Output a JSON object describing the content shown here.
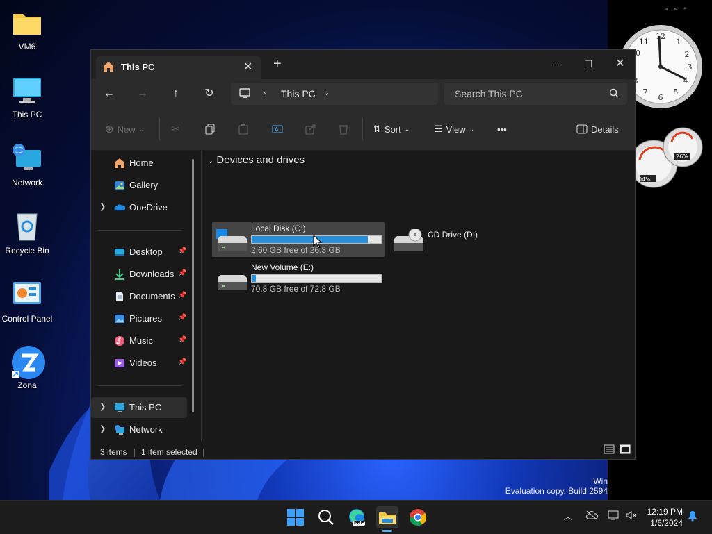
{
  "desktop": {
    "icons": [
      {
        "label": "VM6",
        "icon": "folder-icon"
      },
      {
        "label": "This PC",
        "icon": "monitor-icon"
      },
      {
        "label": "Network",
        "icon": "network-icon"
      },
      {
        "label": "Recycle Bin",
        "icon": "recycle-bin-icon"
      },
      {
        "label": "Control Panel",
        "icon": "control-panel-icon"
      },
      {
        "label": "Zona",
        "icon": "zona-icon"
      }
    ],
    "watermark": {
      "line1": "Win",
      "line2": "Evaluation copy. Build 2594"
    },
    "gadgets": {
      "cpu_label": "04%",
      "ram_label": "26%"
    }
  },
  "window": {
    "tab_title": "This PC",
    "controls": {
      "minimize": "—",
      "maximize": "☐",
      "close": "✕"
    },
    "address": {
      "location": "This PC"
    },
    "search": {
      "placeholder": "Search This PC"
    },
    "toolbar": {
      "new_label": "New",
      "sort_label": "Sort",
      "view_label": "View",
      "more_label": "•••",
      "details_label": "Details"
    },
    "nav": {
      "items": [
        {
          "label": "Home",
          "icon": "home-icon"
        },
        {
          "label": "Gallery",
          "icon": "gallery-icon"
        },
        {
          "label": "OneDrive",
          "icon": "cloud-icon"
        },
        {
          "label": "Desktop",
          "icon": "desktop-folder-icon"
        },
        {
          "label": "Downloads",
          "icon": "download-icon"
        },
        {
          "label": "Documents",
          "icon": "document-icon"
        },
        {
          "label": "Pictures",
          "icon": "pictures-icon"
        },
        {
          "label": "Music",
          "icon": "music-icon"
        },
        {
          "label": "Videos",
          "icon": "videos-icon"
        },
        {
          "label": "This PC",
          "icon": "monitor-icon"
        },
        {
          "label": "Network",
          "icon": "network-icon"
        }
      ]
    },
    "content": {
      "group_title": "Devices and drives",
      "drives": [
        {
          "name": "Local Disk (C:)",
          "free_text": "2.60 GB free of 26.3 GB",
          "used_fraction": 0.9
        },
        {
          "name": "CD Drive (D:)"
        },
        {
          "name": "New Volume (E:)",
          "free_text": "70.8 GB free of 72.8 GB",
          "used_fraction": 0.03
        }
      ]
    },
    "status": {
      "items": "3 items",
      "selected": "1 item selected"
    }
  },
  "taskbar": {
    "clock": {
      "time": "12:19 PM",
      "date": "1/6/2024"
    },
    "edge_badge": "PRE"
  },
  "colors": {
    "accent": "#2a8fd6",
    "window_bg": "#191919",
    "toolbar_bg": "#2b2b2b"
  }
}
